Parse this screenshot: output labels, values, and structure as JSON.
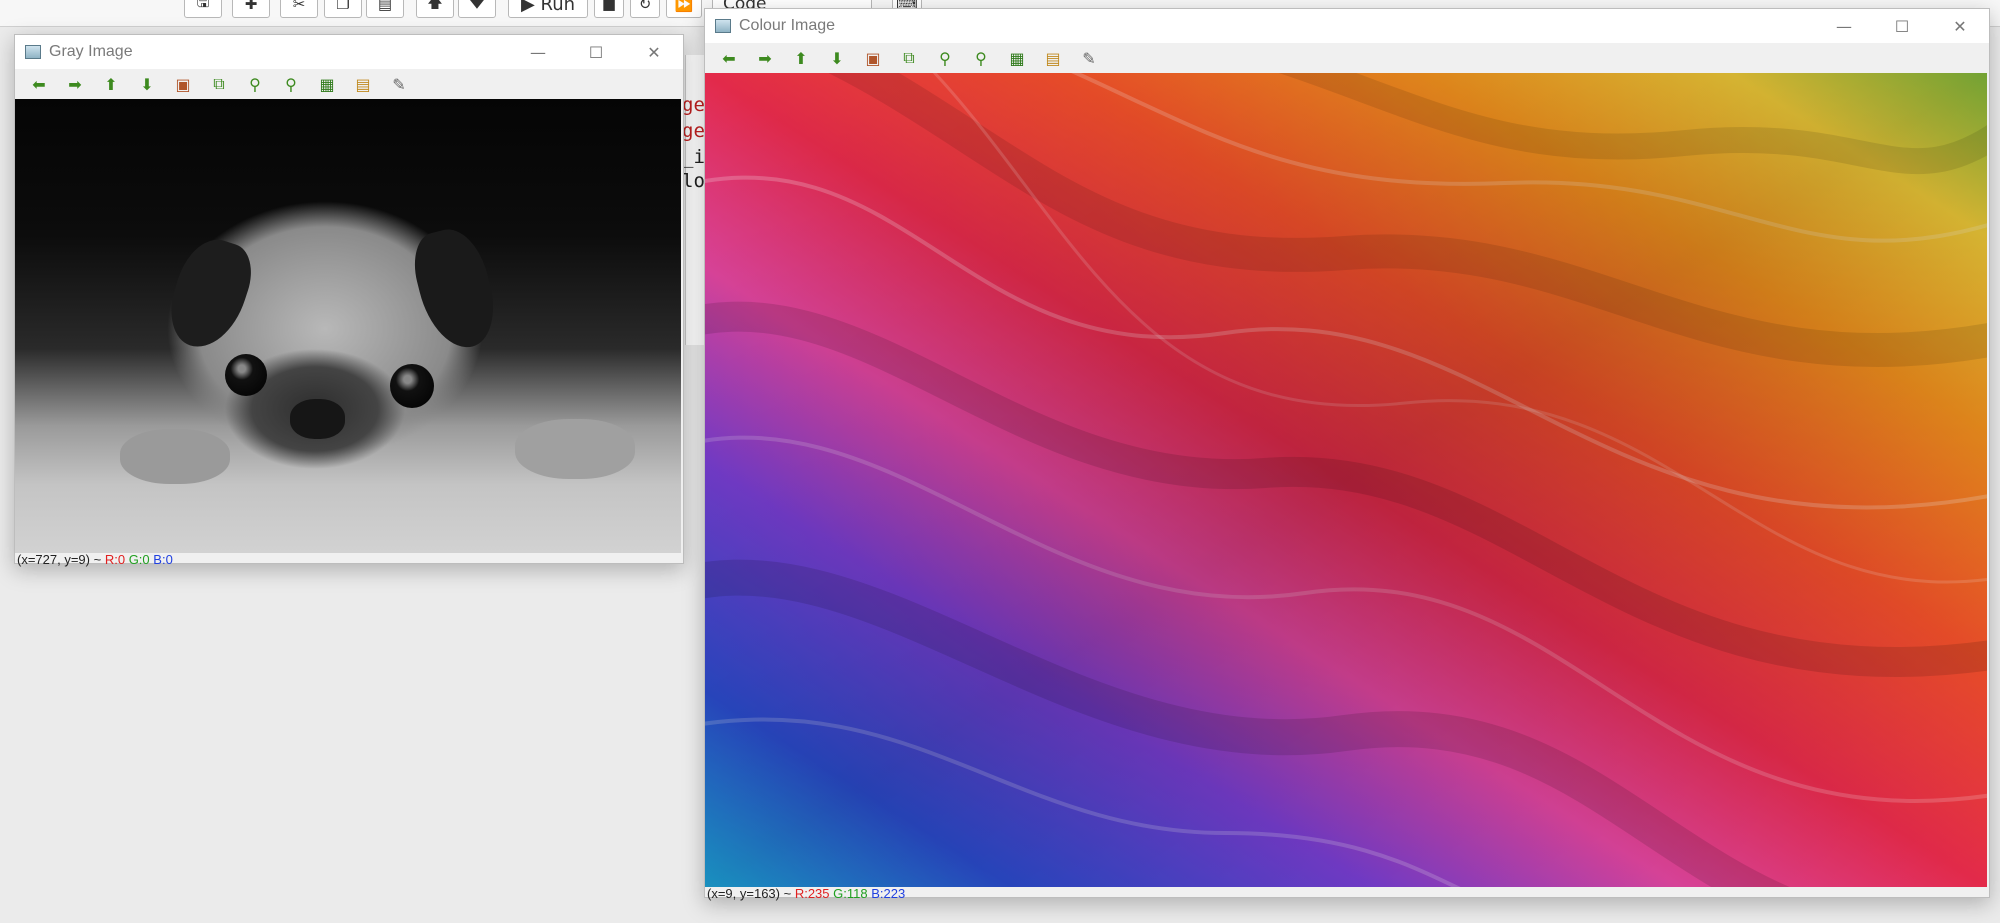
{
  "background_app": {
    "toolbar_buttons": [
      "save-icon",
      "plus-icon",
      "cut-icon",
      "copy-icon",
      "paste-icon",
      "move-up-icon",
      "move-down-icon"
    ],
    "run_label": "Run",
    "cell_type": "Code"
  },
  "gray_window": {
    "title": "Gray Image",
    "status": {
      "coords": "(x=727, y=9) ~",
      "r": "R:0",
      "g": "G:0",
      "b": "B:0"
    }
  },
  "colour_window": {
    "title": "Colour Image",
    "status": {
      "coords": "(x=9, y=163) ~",
      "r": "R:235",
      "g": "G:118",
      "b": "B:223"
    }
  },
  "window_toolbar": [
    {
      "name": "arrow-left-icon",
      "symbol": "⬅",
      "color": "#3d8a1f"
    },
    {
      "name": "arrow-right-icon",
      "symbol": "➡",
      "color": "#3d8a1f"
    },
    {
      "name": "arrow-up-icon",
      "symbol": "⬆",
      "color": "#3d8a1f"
    },
    {
      "name": "arrow-down-icon",
      "symbol": "⬇",
      "color": "#3d8a1f"
    },
    {
      "name": "image-icon",
      "symbol": "▣",
      "color": "#b0552a"
    },
    {
      "name": "zoom-fit-icon",
      "symbol": "⧉",
      "color": "#3d8a1f"
    },
    {
      "name": "zoom-in-icon",
      "symbol": "⚲",
      "color": "#3d8a1f"
    },
    {
      "name": "zoom-out-icon",
      "symbol": "⚲",
      "color": "#3d8a1f"
    },
    {
      "name": "save-icon",
      "symbol": "▦",
      "color": "#2f7a1a"
    },
    {
      "name": "clipboard-icon",
      "symbol": "▤",
      "color": "#c08a20"
    },
    {
      "name": "brush-icon",
      "symbol": "✎",
      "color": "#666666"
    }
  ],
  "window_controls": {
    "minimize": "—",
    "maximize": "☐",
    "close": "✕"
  },
  "colors": {
    "status_r": "#e02020",
    "status_g": "#20a020",
    "status_b": "#2040e0"
  }
}
